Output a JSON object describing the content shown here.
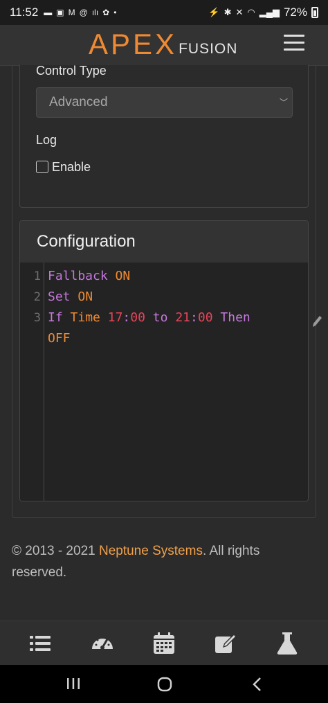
{
  "status_bar": {
    "time": "11:52",
    "battery": "72%"
  },
  "header": {
    "logo_primary": "APEX",
    "logo_secondary": "FUSION"
  },
  "form": {
    "control_type_label": "Control Type",
    "control_type_value": "Advanced",
    "log_label": "Log",
    "enable_label": "Enable",
    "enable_checked": false
  },
  "configuration": {
    "title": "Configuration",
    "line_numbers": [
      "1",
      "2",
      "3"
    ],
    "lines": [
      {
        "kw": "Fallback",
        "arg": "ON"
      },
      {
        "kw": "Set",
        "arg": "ON"
      },
      {
        "kw": "If",
        "field": "Time",
        "t1h": "17",
        "t1m": "00",
        "to": "to",
        "t2h": "21",
        "t2m": "00",
        "then": "Then",
        "result": "OFF"
      }
    ]
  },
  "footer": {
    "copyright": "© 2013 - 2021",
    "company": "Neptune Systems",
    "suffix": ". All rights reserved."
  },
  "colors": {
    "accent": "#f08a32",
    "keyword": "#c678dd",
    "number": "#e8445a"
  }
}
